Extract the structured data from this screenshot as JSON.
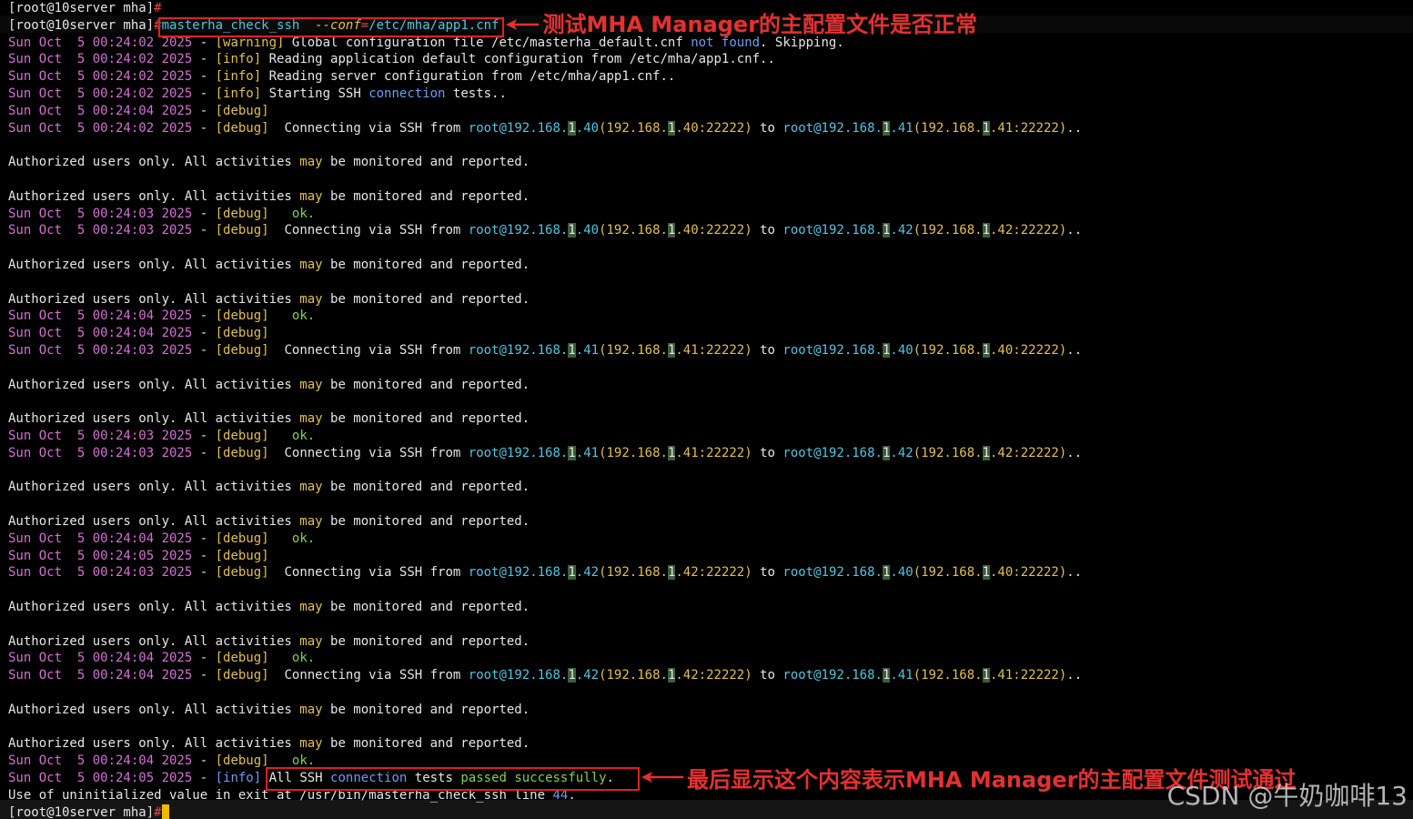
{
  "prompt": {
    "user_host": "[root@10server mha]",
    "symbol": "#"
  },
  "command": {
    "name": "masterha_check_ssh",
    "flag": "--conf",
    "eq": "=",
    "path": "/etc/mha/app1.cnf"
  },
  "header_lines": [
    {
      "date": "Sun Oct  5 00:24:02 2025",
      "level": "[warning]",
      "msg_a": " Global configuration file /etc/masterha_default.cnf ",
      "msg_kw": "not found",
      "msg_b": ". Skipping."
    },
    {
      "date": "Sun Oct  5 00:24:02 2025",
      "level": "[info]",
      "msg_a": " Reading application default configuration from /etc/mha/app1.cnf..",
      "msg_kw": "",
      "msg_b": ""
    },
    {
      "date": "Sun Oct  5 00:24:02 2025",
      "level": "[info]",
      "msg_a": " Reading server configuration from /etc/mha/app1.cnf..",
      "msg_kw": "",
      "msg_b": ""
    },
    {
      "date": "Sun Oct  5 00:24:02 2025",
      "level": "[info]",
      "msg_a": " Starting SSH ",
      "msg_kw": "connection",
      "msg_b": " tests.."
    }
  ],
  "dash": " - ",
  "debug_tag": "[debug]",
  "info_tag": "[info]",
  "ok_text": "ok.",
  "via_text": "  Connecting via SSH from ",
  "to_text": " to ",
  "end_text": "..",
  "auth": {
    "a": "Authorized users only. All activities ",
    "kw": "may",
    "b": " be monitored and reported."
  },
  "blocks": [
    {
      "empty_date": "Sun Oct  5 00:24:04 2025",
      "conn_date": "Sun Oct  5 00:24:02 2025",
      "from": {
        "user": "root@192.168.",
        "hl": "1",
        "ip_end": ".40",
        "paren_a": "(192.168.",
        "paren_hl": "1",
        "paren_b": ".40:22222)"
      },
      "to": {
        "user": "root@192.168.",
        "hl": "1",
        "ip_end": ".41",
        "paren_a": "(192.168.",
        "paren_hl": "1",
        "paren_b": ".41:22222)"
      },
      "ok_date": "Sun Oct  5 00:24:03 2025"
    },
    {
      "empty_date": "",
      "conn_date": "Sun Oct  5 00:24:03 2025",
      "from": {
        "user": "root@192.168.",
        "hl": "1",
        "ip_end": ".40",
        "paren_a": "(192.168.",
        "paren_hl": "1",
        "paren_b": ".40:22222)"
      },
      "to": {
        "user": "root@192.168.",
        "hl": "1",
        "ip_end": ".42",
        "paren_a": "(192.168.",
        "paren_hl": "1",
        "paren_b": ".42:22222)"
      },
      "ok_date": "Sun Oct  5 00:24:04 2025"
    },
    {
      "empty_date": "Sun Oct  5 00:24:04 2025",
      "conn_date": "Sun Oct  5 00:24:03 2025",
      "from": {
        "user": "root@192.168.",
        "hl": "1",
        "ip_end": ".41",
        "paren_a": "(192.168.",
        "paren_hl": "1",
        "paren_b": ".41:22222)"
      },
      "to": {
        "user": "root@192.168.",
        "hl": "1",
        "ip_end": ".40",
        "paren_a": "(192.168.",
        "paren_hl": "1",
        "paren_b": ".40:22222)"
      },
      "ok_date": "Sun Oct  5 00:24:03 2025"
    },
    {
      "empty_date": "",
      "conn_date": "Sun Oct  5 00:24:03 2025",
      "from": {
        "user": "root@192.168.",
        "hl": "1",
        "ip_end": ".41",
        "paren_a": "(192.168.",
        "paren_hl": "1",
        "paren_b": ".41:22222)"
      },
      "to": {
        "user": "root@192.168.",
        "hl": "1",
        "ip_end": ".42",
        "paren_a": "(192.168.",
        "paren_hl": "1",
        "paren_b": ".42:22222)"
      },
      "ok_date": "Sun Oct  5 00:24:04 2025"
    },
    {
      "empty_date": "Sun Oct  5 00:24:05 2025",
      "conn_date": "Sun Oct  5 00:24:03 2025",
      "from": {
        "user": "root@192.168.",
        "hl": "1",
        "ip_end": ".42",
        "paren_a": "(192.168.",
        "paren_hl": "1",
        "paren_b": ".42:22222)"
      },
      "to": {
        "user": "root@192.168.",
        "hl": "1",
        "ip_end": ".40",
        "paren_a": "(192.168.",
        "paren_hl": "1",
        "paren_b": ".40:22222)"
      },
      "ok_date": "Sun Oct  5 00:24:04 2025"
    },
    {
      "empty_date": "",
      "conn_date": "Sun Oct  5 00:24:04 2025",
      "from": {
        "user": "root@192.168.",
        "hl": "1",
        "ip_end": ".42",
        "paren_a": "(192.168.",
        "paren_hl": "1",
        "paren_b": ".42:22222)"
      },
      "to": {
        "user": "root@192.168.",
        "hl": "1",
        "ip_end": ".41",
        "paren_a": "(192.168.",
        "paren_hl": "1",
        "paren_b": ".41:22222)"
      },
      "ok_date": "Sun Oct  5 00:24:04 2025"
    }
  ],
  "final": {
    "date": "Sun Oct  5 00:24:05 2025",
    "level": "[info]",
    "a": "All SSH ",
    "kw1": "connection",
    "b": " tests ",
    "kw2": "passed successfully",
    "c": "."
  },
  "exit_line": {
    "a": "Use of uninitialized value in exit at /usr/bin/masterha_check_ssh line ",
    "num": "44",
    "b": "."
  },
  "annotations": {
    "top": "测试MHA Manager的主配置文件是否正常",
    "bottom": "最后显示这个内容表示MHA Manager的主配置文件测试通过"
  },
  "watermark": "CSDN @牛奶咖啡13",
  "colors": {
    "annotation_red": "#e53030",
    "debug_yellow": "#e3c04a",
    "date_magenta": "#d470d4",
    "ip_cyan": "#4fc6e0",
    "ok_green": "#7fd34a",
    "cursor": "#f0b800"
  }
}
